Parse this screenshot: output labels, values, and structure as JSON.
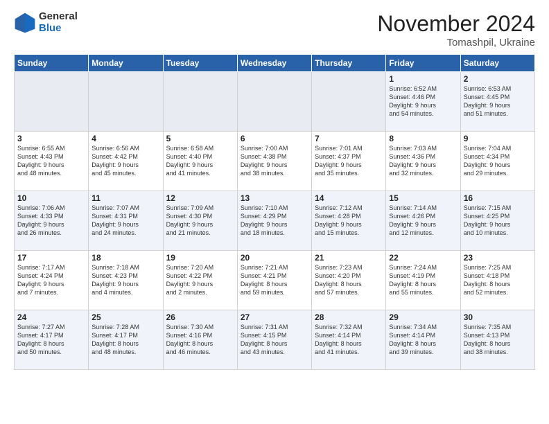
{
  "logo": {
    "general": "General",
    "blue": "Blue"
  },
  "header": {
    "month": "November 2024",
    "location": "Tomashpil, Ukraine"
  },
  "weekdays": [
    "Sunday",
    "Monday",
    "Tuesday",
    "Wednesday",
    "Thursday",
    "Friday",
    "Saturday"
  ],
  "weeks": [
    [
      {
        "day": "",
        "info": ""
      },
      {
        "day": "",
        "info": ""
      },
      {
        "day": "",
        "info": ""
      },
      {
        "day": "",
        "info": ""
      },
      {
        "day": "",
        "info": ""
      },
      {
        "day": "1",
        "info": "Sunrise: 6:52 AM\nSunset: 4:46 PM\nDaylight: 9 hours\nand 54 minutes."
      },
      {
        "day": "2",
        "info": "Sunrise: 6:53 AM\nSunset: 4:45 PM\nDaylight: 9 hours\nand 51 minutes."
      }
    ],
    [
      {
        "day": "3",
        "info": "Sunrise: 6:55 AM\nSunset: 4:43 PM\nDaylight: 9 hours\nand 48 minutes."
      },
      {
        "day": "4",
        "info": "Sunrise: 6:56 AM\nSunset: 4:42 PM\nDaylight: 9 hours\nand 45 minutes."
      },
      {
        "day": "5",
        "info": "Sunrise: 6:58 AM\nSunset: 4:40 PM\nDaylight: 9 hours\nand 41 minutes."
      },
      {
        "day": "6",
        "info": "Sunrise: 7:00 AM\nSunset: 4:38 PM\nDaylight: 9 hours\nand 38 minutes."
      },
      {
        "day": "7",
        "info": "Sunrise: 7:01 AM\nSunset: 4:37 PM\nDaylight: 9 hours\nand 35 minutes."
      },
      {
        "day": "8",
        "info": "Sunrise: 7:03 AM\nSunset: 4:36 PM\nDaylight: 9 hours\nand 32 minutes."
      },
      {
        "day": "9",
        "info": "Sunrise: 7:04 AM\nSunset: 4:34 PM\nDaylight: 9 hours\nand 29 minutes."
      }
    ],
    [
      {
        "day": "10",
        "info": "Sunrise: 7:06 AM\nSunset: 4:33 PM\nDaylight: 9 hours\nand 26 minutes."
      },
      {
        "day": "11",
        "info": "Sunrise: 7:07 AM\nSunset: 4:31 PM\nDaylight: 9 hours\nand 24 minutes."
      },
      {
        "day": "12",
        "info": "Sunrise: 7:09 AM\nSunset: 4:30 PM\nDaylight: 9 hours\nand 21 minutes."
      },
      {
        "day": "13",
        "info": "Sunrise: 7:10 AM\nSunset: 4:29 PM\nDaylight: 9 hours\nand 18 minutes."
      },
      {
        "day": "14",
        "info": "Sunrise: 7:12 AM\nSunset: 4:28 PM\nDaylight: 9 hours\nand 15 minutes."
      },
      {
        "day": "15",
        "info": "Sunrise: 7:14 AM\nSunset: 4:26 PM\nDaylight: 9 hours\nand 12 minutes."
      },
      {
        "day": "16",
        "info": "Sunrise: 7:15 AM\nSunset: 4:25 PM\nDaylight: 9 hours\nand 10 minutes."
      }
    ],
    [
      {
        "day": "17",
        "info": "Sunrise: 7:17 AM\nSunset: 4:24 PM\nDaylight: 9 hours\nand 7 minutes."
      },
      {
        "day": "18",
        "info": "Sunrise: 7:18 AM\nSunset: 4:23 PM\nDaylight: 9 hours\nand 4 minutes."
      },
      {
        "day": "19",
        "info": "Sunrise: 7:20 AM\nSunset: 4:22 PM\nDaylight: 9 hours\nand 2 minutes."
      },
      {
        "day": "20",
        "info": "Sunrise: 7:21 AM\nSunset: 4:21 PM\nDaylight: 8 hours\nand 59 minutes."
      },
      {
        "day": "21",
        "info": "Sunrise: 7:23 AM\nSunset: 4:20 PM\nDaylight: 8 hours\nand 57 minutes."
      },
      {
        "day": "22",
        "info": "Sunrise: 7:24 AM\nSunset: 4:19 PM\nDaylight: 8 hours\nand 55 minutes."
      },
      {
        "day": "23",
        "info": "Sunrise: 7:25 AM\nSunset: 4:18 PM\nDaylight: 8 hours\nand 52 minutes."
      }
    ],
    [
      {
        "day": "24",
        "info": "Sunrise: 7:27 AM\nSunset: 4:17 PM\nDaylight: 8 hours\nand 50 minutes."
      },
      {
        "day": "25",
        "info": "Sunrise: 7:28 AM\nSunset: 4:17 PM\nDaylight: 8 hours\nand 48 minutes."
      },
      {
        "day": "26",
        "info": "Sunrise: 7:30 AM\nSunset: 4:16 PM\nDaylight: 8 hours\nand 46 minutes."
      },
      {
        "day": "27",
        "info": "Sunrise: 7:31 AM\nSunset: 4:15 PM\nDaylight: 8 hours\nand 43 minutes."
      },
      {
        "day": "28",
        "info": "Sunrise: 7:32 AM\nSunset: 4:14 PM\nDaylight: 8 hours\nand 41 minutes."
      },
      {
        "day": "29",
        "info": "Sunrise: 7:34 AM\nSunset: 4:14 PM\nDaylight: 8 hours\nand 39 minutes."
      },
      {
        "day": "30",
        "info": "Sunrise: 7:35 AM\nSunset: 4:13 PM\nDaylight: 8 hours\nand 38 minutes."
      }
    ]
  ]
}
